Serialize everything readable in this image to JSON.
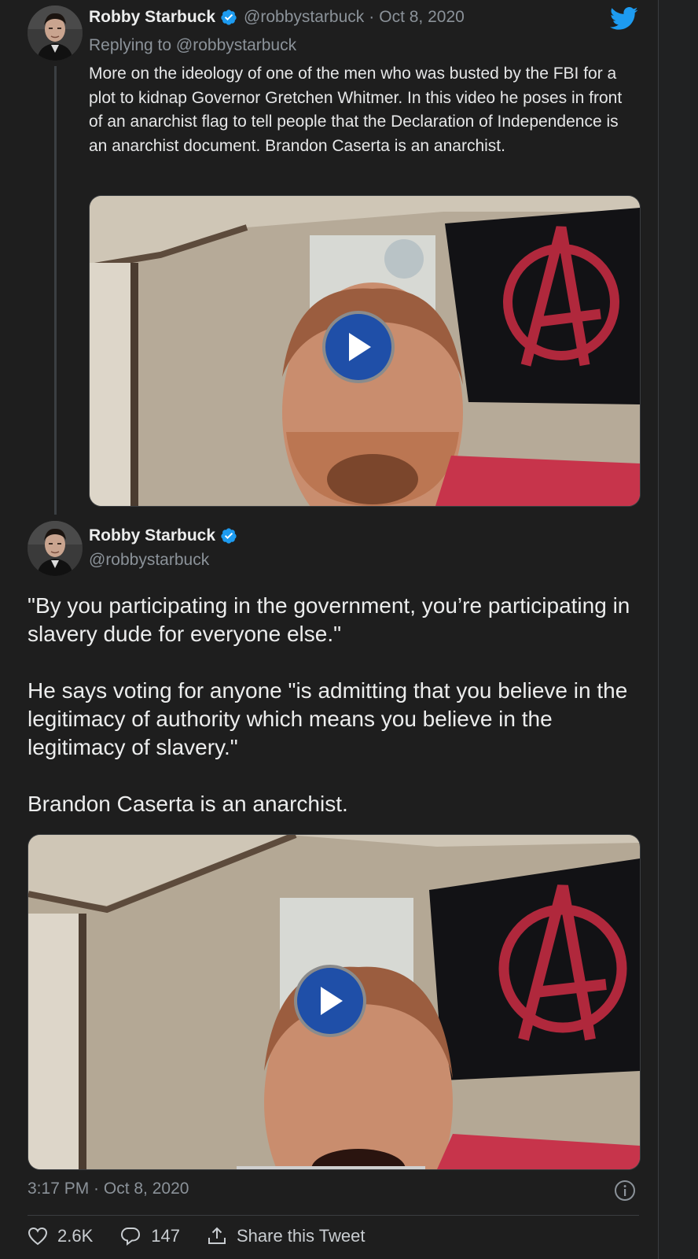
{
  "tweet1": {
    "author_name": "Robby Starbuck",
    "handle": "@robbystarbuck",
    "separator": "·",
    "date": "Oct 8, 2020",
    "replying_to": "Replying to @robbystarbuck",
    "text": "More on the ideology of one of the men who was busted by the FBI for a plot to kidnap Governor Gretchen Whitmer. In this video he poses in front of an anarchist flag to tell people that the Declaration of Independence is an anarchist document. Brandon Caserta is an anarchist."
  },
  "tweet2": {
    "author_name": "Robby Starbuck",
    "handle": "@robbystarbuck",
    "paragraphs": [
      "\"By you participating in the government, you’re participating in slavery dude for everyone else.\"",
      "He says voting for anyone \"is admitting that you believe in the legitimacy of authority which means you believe in the legitimacy of slavery.\"",
      "Brandon Caserta is an anarchist."
    ],
    "timestamp": "3:17 PM · Oct 8, 2020",
    "likes": "2.6K",
    "replies": "147",
    "share_label": "Share this Tweet"
  },
  "colors": {
    "background": "#1e1e1e",
    "verified": "#1d9bf0",
    "twitter_blue": "#1d9bf0",
    "play_button": "#1f4fa8",
    "muted_text": "#8b9299"
  },
  "icons": [
    "verified-badge-icon",
    "twitter-bird-icon",
    "play-icon",
    "info-icon",
    "heart-icon",
    "reply-icon",
    "share-icon"
  ]
}
